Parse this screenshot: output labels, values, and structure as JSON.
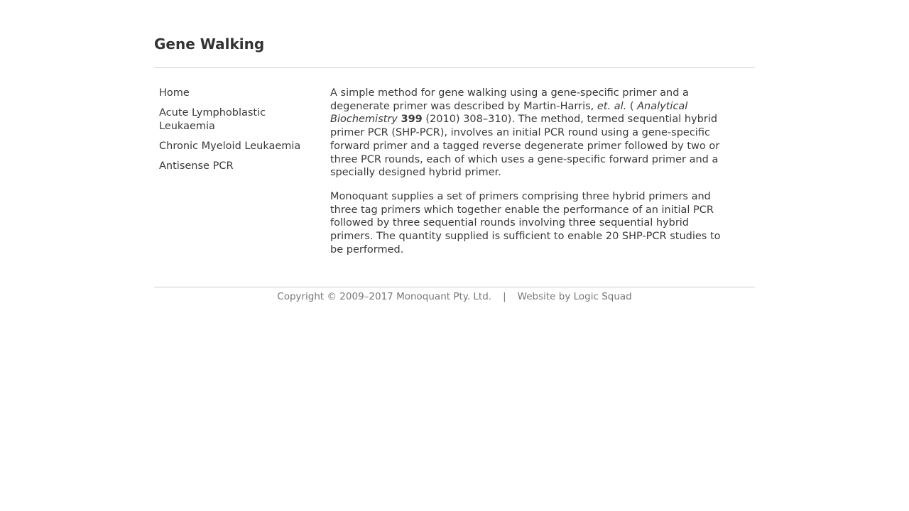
{
  "page": {
    "title": "Gene Walking"
  },
  "sidebar": {
    "items": [
      {
        "label": "Home"
      },
      {
        "label": "Acute Lymphoblastic Leukaemia"
      },
      {
        "label": "Chronic Myeloid Leukaemia"
      },
      {
        "label": "Antisense PCR"
      }
    ]
  },
  "content": {
    "paragraph1": {
      "text_a": "A simple method for gene walking using a gene-specific primer and a degenerate primer was described by Martin-Harris, ",
      "etal": "et. al.",
      "text_b": " ( ",
      "journal": "Analytical Biochemistry",
      "text_c": " ",
      "volume": "399",
      "text_d": " (2010) 308–310). The method, termed sequential hybrid primer PCR (SHP-PCR), involves an initial PCR round using a gene-specific forward primer and a tagged reverse degenerate primer followed by two or three PCR rounds, each of which uses a gene-specific forward primer and a specially designed hybrid primer."
    },
    "paragraph2": "Monoquant supplies a set of primers comprising three hybrid primers and three tag primers which together enable the performance of an initial PCR followed by three sequential rounds involving three sequential hybrid primers. The quantity supplied is sufficient to enable 20 SHP-PCR studies to be performed."
  },
  "footer": {
    "copyright": "Copyright © 2009–2017 Monoquant Pty. Ltd.",
    "separator": "|",
    "credit": "Website by Logic Squad"
  }
}
